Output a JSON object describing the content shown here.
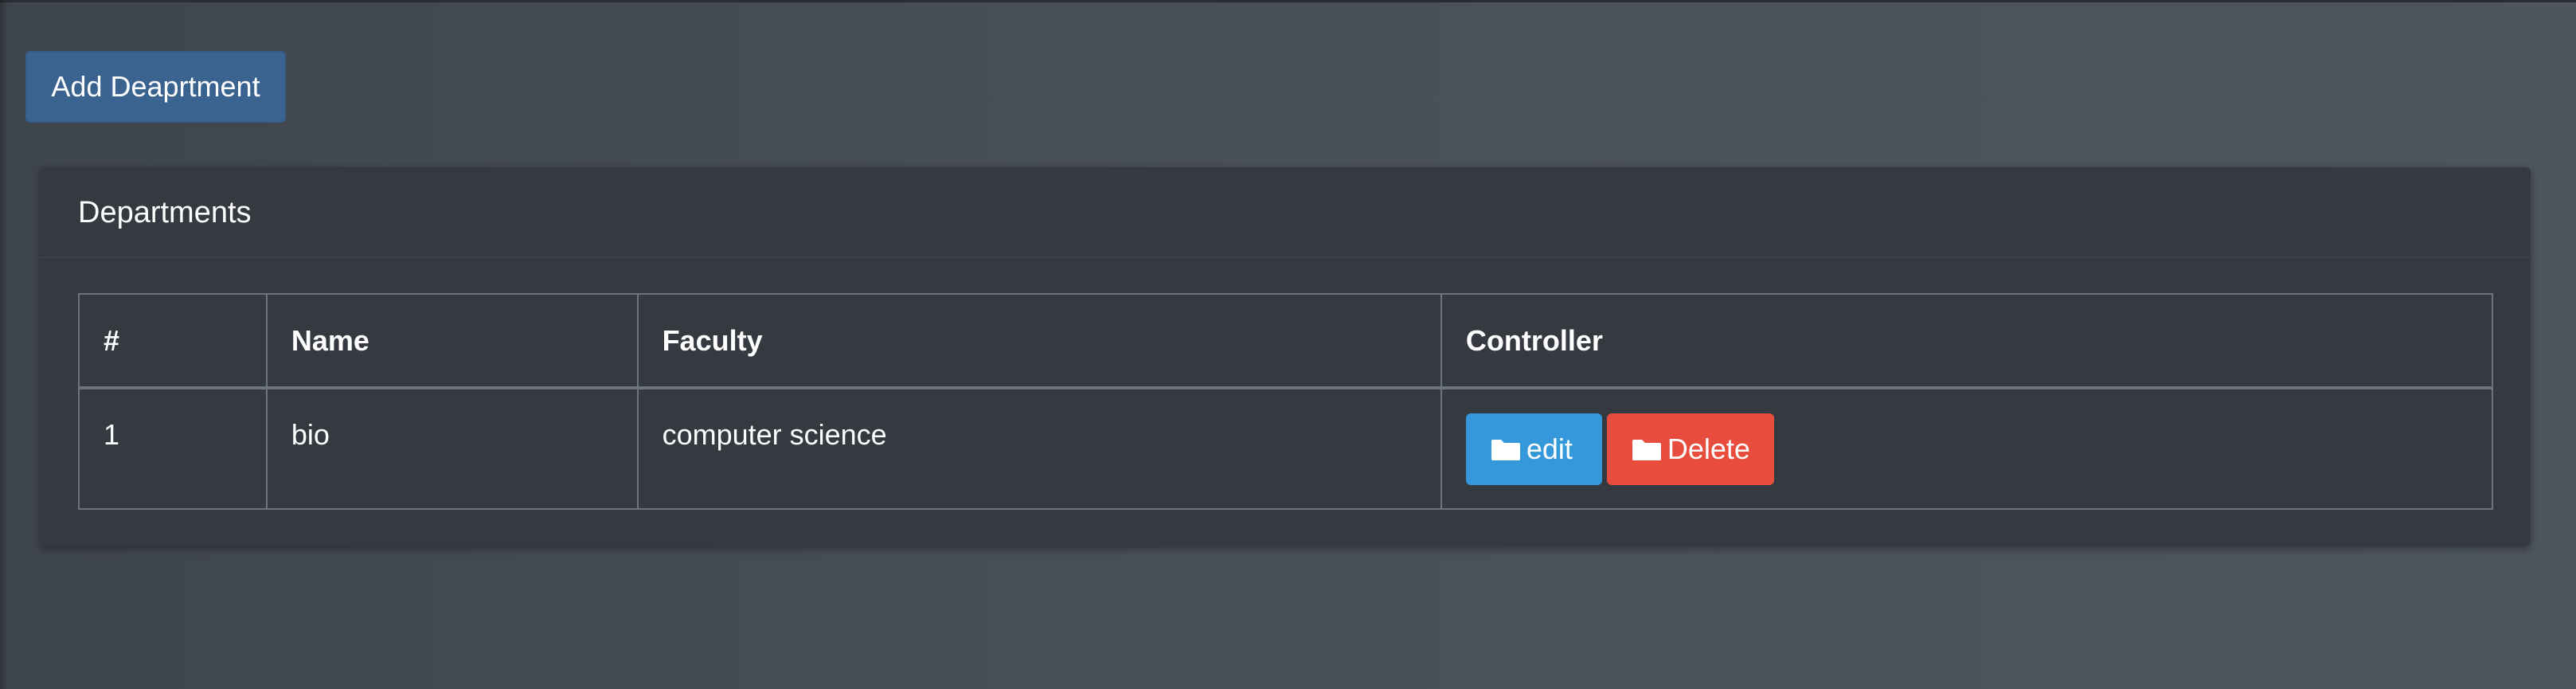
{
  "toolbar": {
    "add_label": "Add Deaprtment"
  },
  "card": {
    "title": "Departments"
  },
  "table": {
    "headers": [
      "#",
      "Name",
      "Faculty",
      "Controller"
    ],
    "rows": [
      {
        "num": "1",
        "name": "bio",
        "faculty": "computer science",
        "edit_label": "edit",
        "delete_label": "Delete"
      }
    ]
  },
  "icons": {
    "edit": "folder-icon",
    "delete": "folder-icon"
  },
  "colors": {
    "primary": "#3b6390",
    "info": "#3498db",
    "danger": "#e74c3c",
    "card_bg": "#343a40",
    "page_bg": "#474d55"
  }
}
